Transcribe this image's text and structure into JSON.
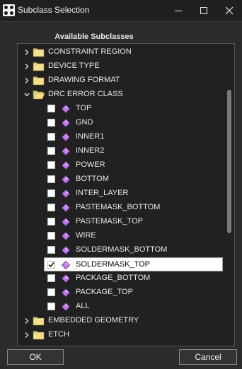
{
  "window": {
    "title": "Subclass Selection",
    "icon": "cadence-app-icon",
    "controls": [
      "minimize-icon",
      "maximize-icon",
      "close-icon"
    ]
  },
  "panel_label": "Available Subclasses",
  "tree": {
    "before": [
      {
        "label": "CONSTRAINT REGION",
        "expanded": false
      },
      {
        "label": "DEVICE TYPE",
        "expanded": false
      },
      {
        "label": "DRAWING FORMAT",
        "expanded": false
      },
      {
        "label": "DRC ERROR CLASS",
        "expanded": true
      }
    ],
    "children": [
      {
        "label": "TOP",
        "checked": false
      },
      {
        "label": "GND",
        "checked": false
      },
      {
        "label": "INNER1",
        "checked": false
      },
      {
        "label": "INNER2",
        "checked": false
      },
      {
        "label": "POWER",
        "checked": false
      },
      {
        "label": "BOTTOM",
        "checked": false
      },
      {
        "label": "INTER_LAYER",
        "checked": false
      },
      {
        "label": "PASTEMASK_BOTTOM",
        "checked": false
      },
      {
        "label": "PASTEMASK_TOP",
        "checked": false
      },
      {
        "label": "WIRE",
        "checked": false
      },
      {
        "label": "SOLDERMASK_BOTTOM",
        "checked": false
      },
      {
        "label": "SOLDERMASK_TOP",
        "checked": true
      },
      {
        "label": "PACKAGE_BOTTOM",
        "checked": false
      },
      {
        "label": "PACKAGE_TOP",
        "checked": false
      },
      {
        "label": "ALL",
        "checked": false
      }
    ],
    "after": [
      {
        "label": "EMBEDDED GEOMETRY",
        "expanded": false
      },
      {
        "label": "ETCH",
        "expanded": false
      }
    ]
  },
  "scroll": {
    "thumb_start": 0.15,
    "thumb_end": 0.63
  },
  "buttons": {
    "ok": "OK",
    "cancel": "Cancel"
  },
  "colors": {
    "background": "#2b2b2b",
    "tree_background": "#212121",
    "folder": "#f2e08c",
    "subclass_icon": "#c37de8",
    "selection": "#ffffff"
  }
}
